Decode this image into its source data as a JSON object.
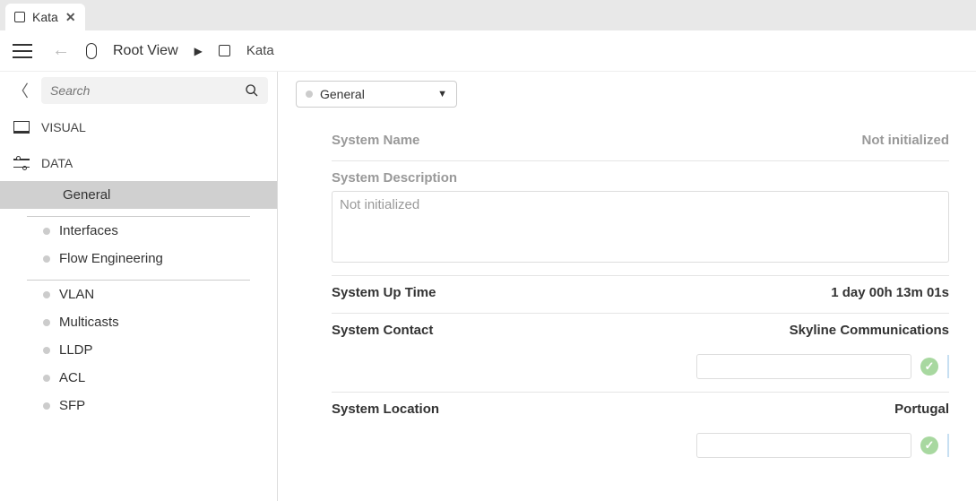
{
  "tab": {
    "title": "Kata"
  },
  "breadcrumb": {
    "root": "Root View",
    "leaf": "Kata"
  },
  "search": {
    "placeholder": "Search"
  },
  "sections": {
    "visual": "VISUAL",
    "data": "DATA"
  },
  "data_items": {
    "group1": [
      "General"
    ],
    "group2": [
      "Interfaces",
      "Flow Engineering"
    ],
    "group3": [
      "VLAN",
      "Multicasts",
      "LLDP",
      "ACL",
      "SFP"
    ]
  },
  "page_selector": {
    "value": "General"
  },
  "fields": {
    "system_name": {
      "label": "System Name",
      "value": "Not initialized"
    },
    "system_description": {
      "label": "System Description",
      "value": "Not initialized"
    },
    "system_uptime": {
      "label": "System Up Time",
      "value": "1 day 00h 13m 01s"
    },
    "system_contact": {
      "label": "System Contact",
      "value": "Skyline Communications",
      "input_value": ""
    },
    "system_location": {
      "label": "System Location",
      "value": "Portugal",
      "input_value": ""
    }
  }
}
